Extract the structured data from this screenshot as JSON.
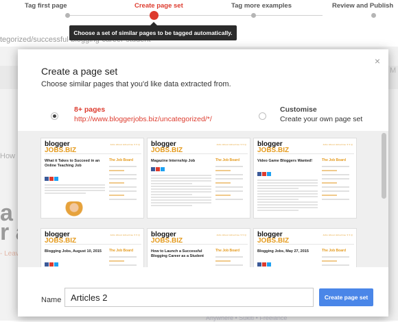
{
  "stepper": {
    "steps": [
      {
        "label": "Tag first page"
      },
      {
        "label": "Create page set"
      },
      {
        "label": "Tag more examples"
      },
      {
        "label": "Review and Publish"
      }
    ],
    "active_index": 1,
    "tooltip": "Choose a set of similar pages to be tagged automatically."
  },
  "background": {
    "url_fragment": "tegorized/successful-blogging-career-student",
    "how_text": "How",
    "big_text_1": "a",
    "big_text_2": "r a",
    "leave_text": "- Leav",
    "right_letter": "M",
    "footer_links": "Anywhere  •  Sukiti  •  Freelance"
  },
  "dialog": {
    "title": "Create a page set",
    "subtitle": "Choose similar pages that you'd like data extracted from.",
    "option_pages": {
      "label": "8+ pages",
      "url": "http://www.bloggerjobs.biz/uncategorized/*/",
      "selected": true
    },
    "option_custom": {
      "label": "Customise",
      "sublabel": "Create your own page set",
      "selected": false
    },
    "thumb_common": {
      "logo_top": "blogger",
      "logo_bottom": "JOBS.BIZ",
      "nav": "Jobs   About   Advertise   ▾   ▾   Q",
      "sidebar_title": "The Job Board"
    },
    "thumbnails": [
      {
        "headline": "What it Takes to Succeed in an Online Teaching Job"
      },
      {
        "headline": "Magazine Internship Job"
      },
      {
        "headline": "Video Game Bloggers Wanted!"
      },
      {
        "headline": "Blogging Jobs, August 10, 2015"
      },
      {
        "headline": "How to Launch a Successful Blogging Career as a Student"
      },
      {
        "headline": "Blogging Jobs, May 27, 2015"
      }
    ],
    "name_label": "Name",
    "name_value": "Articles 2",
    "create_label": "Create page set",
    "close_glyph": "×"
  },
  "colors": {
    "accent_red": "#dd3b2e",
    "button_blue": "#4a86e8",
    "logo_orange": "#e49a1d"
  }
}
